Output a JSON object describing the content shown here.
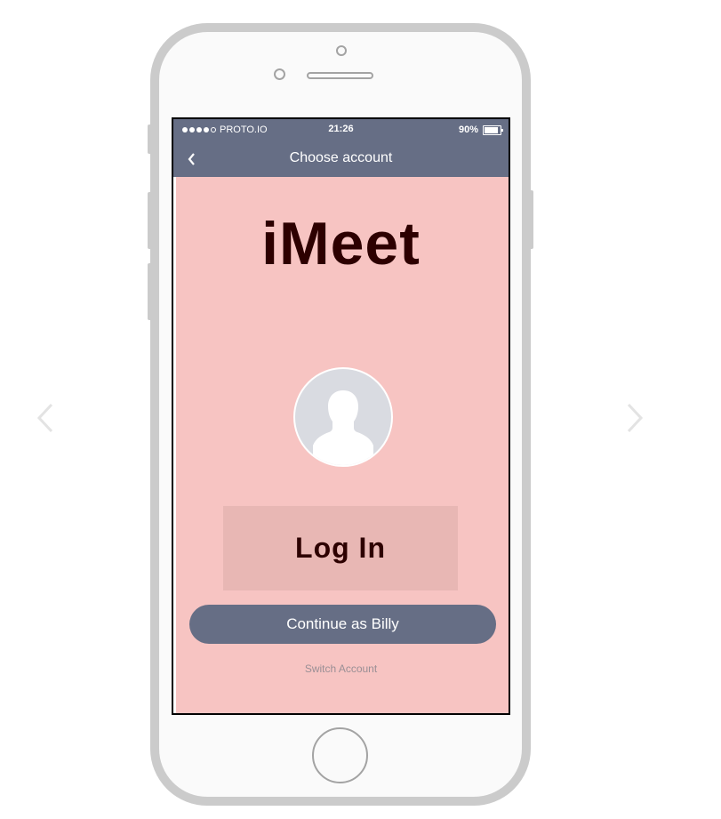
{
  "status_bar": {
    "carrier": "PROTO.IO",
    "time": "21:26",
    "battery": "90%",
    "battery_level": 0.9
  },
  "header": {
    "title": "Choose account",
    "back_icon": "chevron-left-icon"
  },
  "main": {
    "logo_text": "iMeet",
    "avatar_icon": "user-silhouette-icon",
    "login_label": "Log In",
    "continue_label": "Continue as Billy",
    "switch_label": "Switch Account"
  },
  "navigation": {
    "prev_icon": "chevron-left-icon",
    "next_icon": "chevron-right-icon"
  },
  "colors": {
    "header_bg": "#666e85",
    "content_bg": "#f7c4c2",
    "login_bg": "#e8b7b4",
    "logo_text": "#2d0000",
    "device_frame": "#cbcbcb"
  }
}
